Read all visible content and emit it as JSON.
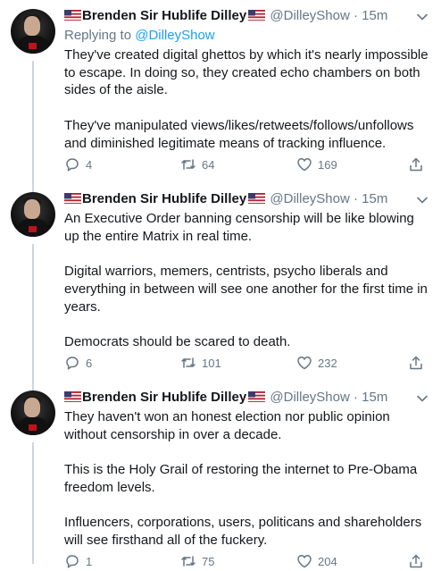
{
  "tweets": [
    {
      "name": "Brenden Sir Hublife Dilley",
      "handle": "@DilleyShow",
      "dot": "·",
      "time": "15m",
      "replying_label": "Replying to",
      "replying_to": "@DilleyShow",
      "text": "They've created digital ghettos by which it's nearly impossible to escape. In doing so, they created echo chambers on both sides of the aisle.\n\nThey've manipulated views/likes/retweets/follows/unfollows and diminished legitimate means of tracking influence.",
      "replies": "4",
      "retweets": "64",
      "likes": "169"
    },
    {
      "name": "Brenden Sir Hublife Dilley",
      "handle": "@DilleyShow",
      "dot": "·",
      "time": "15m",
      "text": "An Executive Order banning censorship will be like blowing up the entire Matrix in real time.\n\nDigital warriors, memers, centrists, psycho liberals and everything in between will see one another for the first time in years.\n\nDemocrats should be scared to death.",
      "replies": "6",
      "retweets": "101",
      "likes": "232"
    },
    {
      "name": "Brenden Sir Hublife Dilley",
      "handle": "@DilleyShow",
      "dot": "·",
      "time": "15m",
      "text": "They haven't won an honest election nor public opinion without censorship in over a decade.\n\nThis is the Holy Grail of restoring the internet to Pre-Obama freedom levels.\n\nInfluencers, corporations, users, politicans and shareholders will see firsthand all of the fuckery.",
      "replies": "1",
      "retweets": "75",
      "likes": "204"
    }
  ],
  "icons": {
    "flag": "us-flag-icon",
    "reply": "reply-icon",
    "retweet": "retweet-icon",
    "like": "heart-icon",
    "share": "share-icon",
    "more": "chevron-down-icon"
  },
  "colors": {
    "link": "#1da1f2",
    "secondary_text": "#657786",
    "thread_line": "#ccd6dd"
  }
}
